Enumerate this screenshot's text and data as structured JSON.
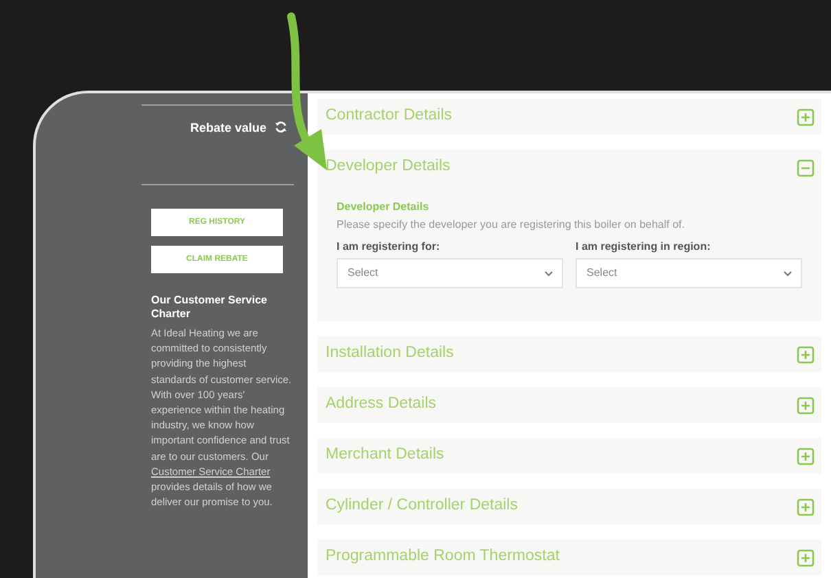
{
  "sidebar": {
    "rebate_label": "Rebate value",
    "buttons": [
      {
        "label": "REG HISTORY"
      },
      {
        "label": "CLAIM REBATE"
      }
    ],
    "charter": {
      "title": "Our Customer Service Charter",
      "text_before": "At Ideal Heating we are committed to consistently providing the highest standards of customer service. With over 100 years' experience within the heating industry, we know how important confidence and trust are to our customers. Our ",
      "link": "Customer Service Charter",
      "text_after": " provides details of how we deliver our promise to you."
    }
  },
  "sections": [
    {
      "title": "Contractor Details",
      "expanded": false
    },
    {
      "title": "Developer Details",
      "expanded": true,
      "subtitle": "Developer Details",
      "description": "Please specify the developer you are registering this boiler on behalf of.",
      "fields": [
        {
          "label": "I am registering for:",
          "value": "Select"
        },
        {
          "label": "I am registering in region:",
          "value": "Select"
        }
      ]
    },
    {
      "title": "Installation Details",
      "expanded": false
    },
    {
      "title": "Address Details",
      "expanded": false
    },
    {
      "title": "Merchant Details",
      "expanded": false
    },
    {
      "title": "Cylinder / Controller Details",
      "expanded": false
    },
    {
      "title": "Programmable Room Thermostat",
      "expanded": false
    }
  ]
}
